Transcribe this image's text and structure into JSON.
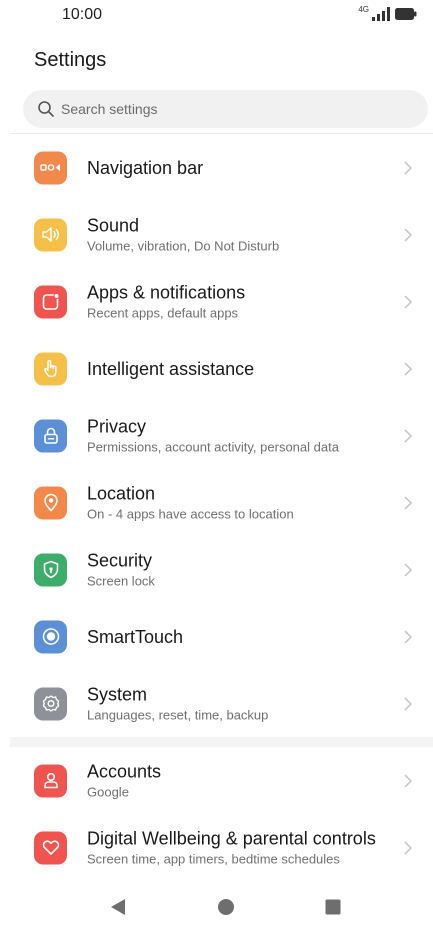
{
  "status_bar": {
    "time": "10:00",
    "network": "4G"
  },
  "header": {
    "title": "Settings"
  },
  "search": {
    "placeholder": "Search settings"
  },
  "items": [
    {
      "id": "navigation-bar",
      "label": "Navigation bar",
      "subtitle": "",
      "icon": "navigation-bar-icon",
      "color": "#f2894b"
    },
    {
      "id": "sound",
      "label": "Sound",
      "subtitle": "Volume, vibration, Do Not Disturb",
      "icon": "sound-icon",
      "color": "#f5c04a"
    },
    {
      "id": "apps-notifications",
      "label": "Apps & notifications",
      "subtitle": "Recent apps, default apps",
      "icon": "apps-notifications-icon",
      "color": "#f0544f"
    },
    {
      "id": "intelligent-assistance",
      "label": "Intelligent assistance",
      "subtitle": "",
      "icon": "hand-icon",
      "color": "#f5c04a"
    },
    {
      "id": "privacy",
      "label": "Privacy",
      "subtitle": "Permissions, account activity, personal data",
      "icon": "lock-icon",
      "color": "#5b8fd6"
    },
    {
      "id": "location",
      "label": "Location",
      "subtitle": "On - 4 apps have access to location",
      "icon": "location-pin-icon",
      "color": "#f2894b"
    },
    {
      "id": "security",
      "label": "Security",
      "subtitle": "Screen lock",
      "icon": "shield-icon",
      "color": "#3dae6a"
    },
    {
      "id": "smarttouch",
      "label": "SmartTouch",
      "subtitle": "",
      "icon": "smarttouch-icon",
      "color": "#5b8fd6"
    },
    {
      "id": "system",
      "label": "System",
      "subtitle": "Languages, reset, time, backup",
      "icon": "gear-icon",
      "color": "#8e9197"
    }
  ],
  "items2": [
    {
      "id": "accounts",
      "label": "Accounts",
      "subtitle": "Google",
      "icon": "person-icon",
      "color": "#f0544f"
    },
    {
      "id": "digital-wellbeing",
      "label": "Digital Wellbeing & parental controls",
      "subtitle": "Screen time, app timers, bedtime schedules",
      "icon": "heart-icon",
      "color": "#f0544f"
    }
  ],
  "nav_bar": {
    "back": "back-triangle-icon",
    "home": "home-circle-icon",
    "recents": "recents-square-icon"
  }
}
